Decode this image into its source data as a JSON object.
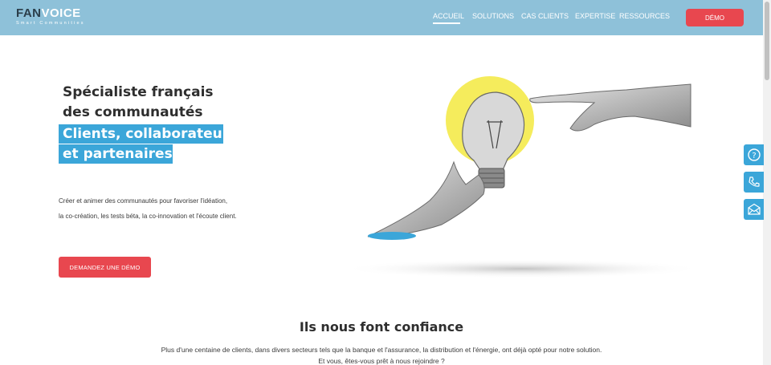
{
  "header": {
    "logo_main_1": "FAN",
    "logo_main_2": "VOICE",
    "logo_sub": "Smart Communities",
    "nav": [
      {
        "label": "ACCUEIL",
        "active": true
      },
      {
        "label": "SOLUTIONS"
      },
      {
        "label": "CAS CLIENTS"
      },
      {
        "label": "EXPERTISE"
      },
      {
        "label": "RESSOURCES"
      }
    ],
    "demo_label": "DÉMO"
  },
  "hero": {
    "title_line1": "Spécialiste français",
    "title_line2": "des communautés",
    "highlight_line1": "Clients, collaborateurs",
    "highlight_line2": "et partenaires.",
    "desc_line1": "Créer et animer des communautés pour favoriser l'idéation,",
    "desc_line2": "la co-création, les tests béta, la co-innovation et l'écoute client.",
    "cta_label": "DEMANDEZ UNE DÉMO"
  },
  "side_buttons": [
    "question-icon",
    "phone-icon",
    "mail-icon"
  ],
  "trust": {
    "title": "Ils nous font confiance",
    "text_line1": "Plus d'une centaine de clients, dans divers secteurs tels que la banque et l'assurance, la distribution et l'énergie, ont déjà opté pour notre solution.",
    "text_line2": "Et vous, êtes-vous prêt à nous rejoindre ?"
  },
  "colors": {
    "header_bg": "#8ec1d9",
    "accent_blue": "#3ba6d9",
    "accent_red": "#e8474f",
    "bulb_yellow": "#f5ec5c"
  }
}
